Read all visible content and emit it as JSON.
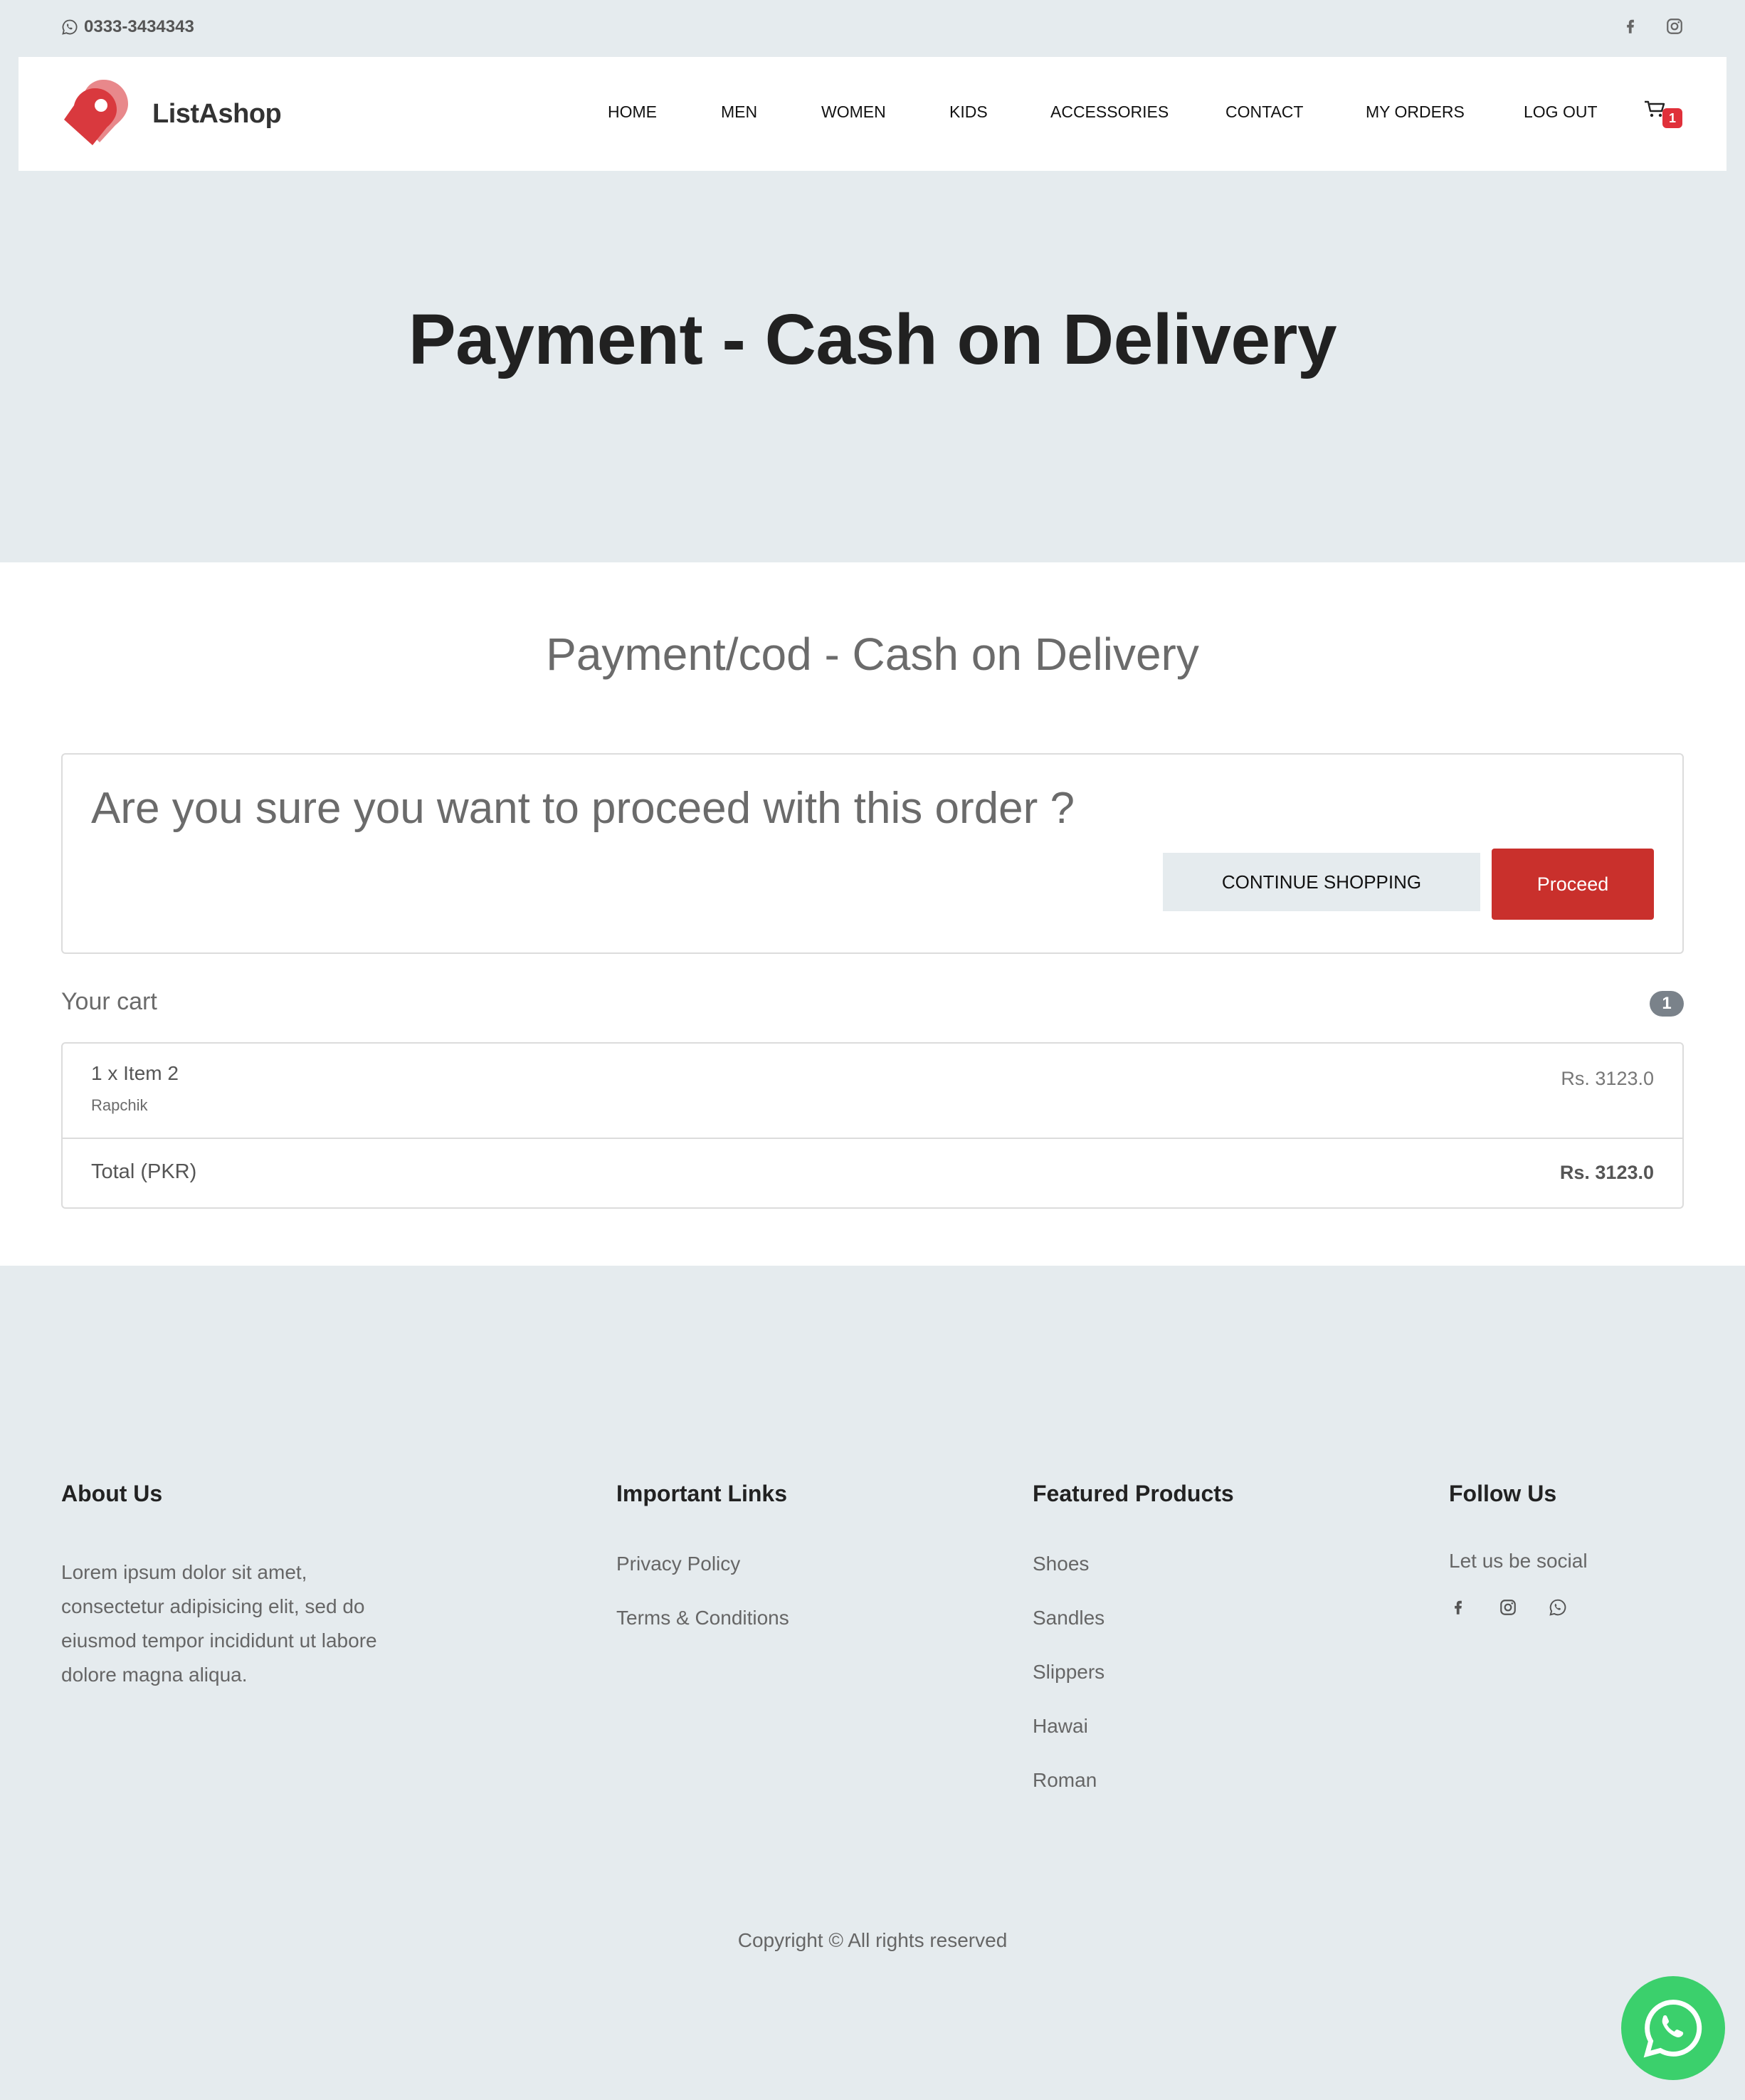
{
  "topbar": {
    "phone": "0333-3434343",
    "social_icons": [
      "facebook-icon",
      "instagram-icon"
    ]
  },
  "brand": {
    "name": "ListAshop",
    "accent_color": "#d9393e"
  },
  "nav": {
    "items": [
      {
        "label": "HOME"
      },
      {
        "label": "MEN"
      },
      {
        "label": "WOMEN"
      },
      {
        "label": "KIDS"
      },
      {
        "label": "ACCESSORIES"
      },
      {
        "label": "CONTACT"
      },
      {
        "label": "MY ORDERS"
      },
      {
        "label": "LOG OUT"
      }
    ],
    "cart_count": "1"
  },
  "hero": {
    "title": "Payment - Cash on Delivery"
  },
  "payment": {
    "subtitle": "Payment/cod - Cash on Delivery",
    "question": "Are you sure you want to proceed with this order ?",
    "continue_label": "CONTINUE SHOPPING",
    "proceed_label": "Proceed",
    "proceed_color": "#c9302c"
  },
  "cart": {
    "heading": "Your cart",
    "count": "1",
    "items": [
      {
        "name": "1 x Item 2",
        "brand": "Rapchik",
        "price": "Rs. 3123.0"
      }
    ],
    "total_label": "Total (PKR)",
    "total_value": "Rs. 3123.0"
  },
  "footer": {
    "about": {
      "title": "About Us",
      "text": "Lorem ipsum dolor sit amet, consectetur adipisicing elit, sed do eiusmod tempor incididunt ut labore dolore magna aliqua."
    },
    "links": {
      "title": "Important Links",
      "items": [
        "Privacy Policy",
        "Terms & Conditions"
      ]
    },
    "featured": {
      "title": "Featured Products",
      "items": [
        "Shoes",
        "Sandles",
        "Slippers",
        "Hawai",
        "Roman"
      ]
    },
    "follow": {
      "title": "Follow Us",
      "text": "Let us be social",
      "icons": [
        "facebook-icon",
        "instagram-icon",
        "whatsapp-icon"
      ]
    },
    "copyright": "Copyright © All rights reserved"
  },
  "whatsapp_fab": {
    "icon": "whatsapp-icon",
    "color": "#3bd06c"
  }
}
